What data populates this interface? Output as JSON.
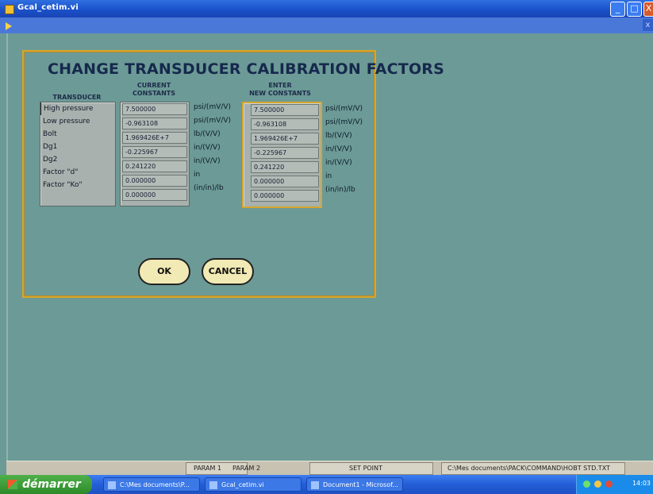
{
  "window": {
    "title": "Gcal_cetim.vi",
    "buttons": {
      "minimize": "_",
      "maximize": "□",
      "close": "X"
    },
    "toolbar_close": "x"
  },
  "panel": {
    "title": "CHANGE TRANSDUCER CALIBRATION FACTORS",
    "col_transducer": "TRANSDUCER",
    "col_current": "CURRENT\nCONSTANTS",
    "col_new": "ENTER\nNEW CONSTANTS",
    "rows": [
      {
        "name": "High pressure",
        "current": "7.500000",
        "unit": "psi/(mV/V)",
        "new": "7.500000",
        "new_unit": "psi/(mV/V)"
      },
      {
        "name": "Low pressure",
        "current": "-0.963108",
        "unit": "psi/(mV/V)",
        "new": "-0.963108",
        "new_unit": "psi/(mV/V)"
      },
      {
        "name": "Bolt",
        "current": "1.969426E+7",
        "unit": "lb/(V/V)",
        "new": "1.969426E+7",
        "new_unit": "lb/(V/V)"
      },
      {
        "name": "Dg1",
        "current": "-0.225967",
        "unit": "in/(V/V)",
        "new": "-0.225967",
        "new_unit": "in/(V/V)"
      },
      {
        "name": "Dg2",
        "current": "0.241220",
        "unit": "in/(V/V)",
        "new": "0.241220",
        "new_unit": "in/(V/V)"
      },
      {
        "name": "Factor \"d\"",
        "current": "0.000000",
        "unit": "in",
        "new": "0.000000",
        "new_unit": "in"
      },
      {
        "name": "Factor \"Ko\"",
        "current": "0.000000",
        "unit": "(in/in)/lb",
        "new": "0.000000",
        "new_unit": "(in/in)/lb"
      }
    ],
    "ok": "OK",
    "cancel": "CANCEL"
  },
  "statusbar": {
    "param1": "PARAM 1",
    "param2": "PARAM 2",
    "setpoint": "SET POINT",
    "path": "C:\\Mes documents\\PACK\\COMMAND\\HOBT STD.TXT"
  },
  "taskbar": {
    "start": "démarrer",
    "tasks": [
      "C:\\Mes documents\\P...",
      "Gcal_cetim.vi",
      "Document1 - Microsof..."
    ],
    "clock": "14:03"
  }
}
